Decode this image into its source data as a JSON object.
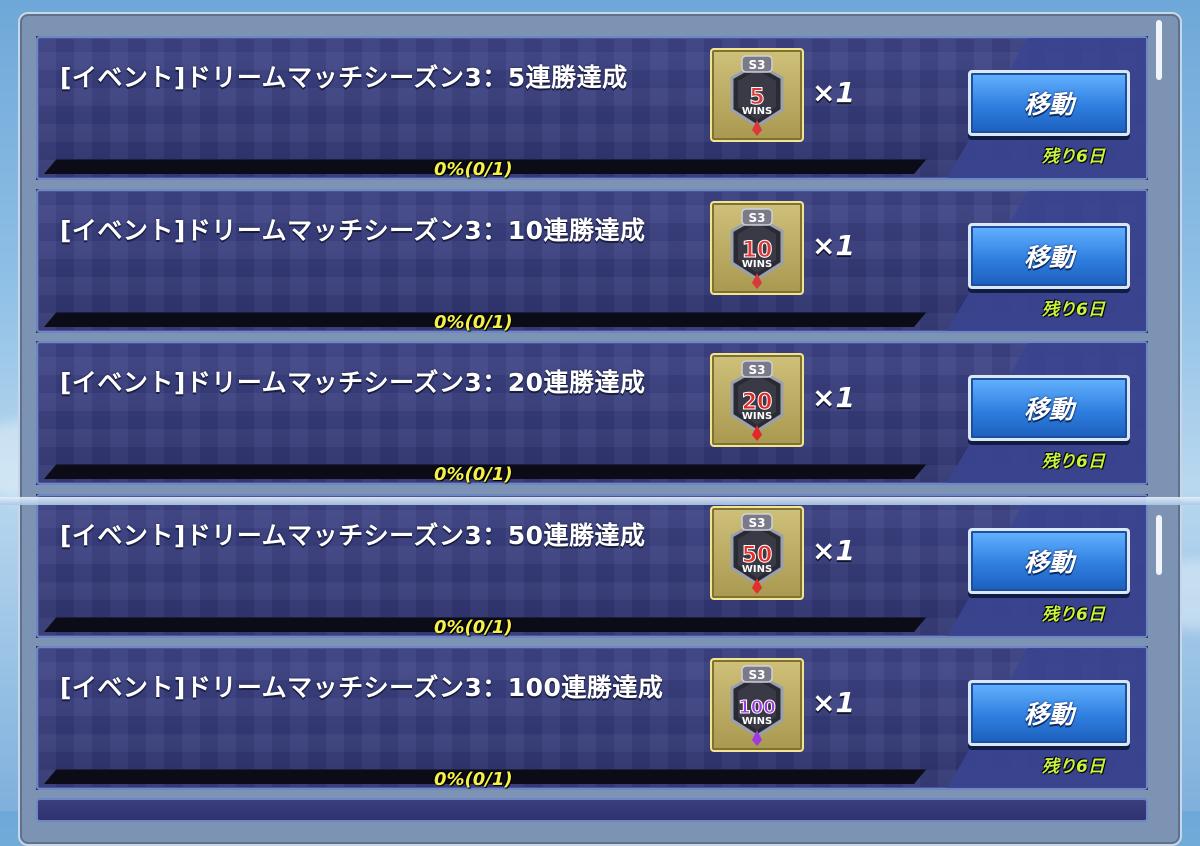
{
  "missions": [
    {
      "title": "[イベント]ドリームマッチシーズン3：5連勝達成",
      "badge_season": "S3",
      "badge_number": "5",
      "badge_wins": "WINS",
      "badge_color": "#d83a3a",
      "quantity": "×1",
      "button_label": "移動",
      "progress_text": "0%(0/1)",
      "progress": 0,
      "remaining": "残り6日"
    },
    {
      "title": "[イベント]ドリームマッチシーズン3：10連勝達成",
      "badge_season": "S3",
      "badge_number": "10",
      "badge_wins": "WINS",
      "badge_color": "#d83a3a",
      "quantity": "×1",
      "button_label": "移動",
      "progress_text": "0%(0/1)",
      "progress": 0,
      "remaining": "残り6日"
    },
    {
      "title": "[イベント]ドリームマッチシーズン3：20連勝達成",
      "badge_season": "S3",
      "badge_number": "20",
      "badge_wins": "WINS",
      "badge_color": "#e02828",
      "quantity": "×1",
      "button_label": "移動",
      "progress_text": "0%(0/1)",
      "progress": 0,
      "remaining": "残り6日"
    },
    {
      "title": "[イベント]ドリームマッチシーズン3：50連勝達成",
      "badge_season": "S3",
      "badge_number": "50",
      "badge_wins": "WINS",
      "badge_color": "#e0302a",
      "quantity": "×1",
      "button_label": "移動",
      "progress_text": "0%(0/1)",
      "progress": 0,
      "remaining": "残り6日"
    },
    {
      "title": "[イベント]ドリームマッチシーズン3：100連勝達成",
      "badge_season": "S3",
      "badge_number": "100",
      "badge_wins": "WINS",
      "badge_color": "#a03ae0",
      "quantity": "×1",
      "button_label": "移動",
      "progress_text": "0%(0/1)",
      "progress": 0,
      "remaining": "残り6日"
    }
  ],
  "colors": {
    "accent_yellow": "#f5f14a",
    "remaining_green": "#c7f23f",
    "button_blue": "#2f7fe0"
  }
}
